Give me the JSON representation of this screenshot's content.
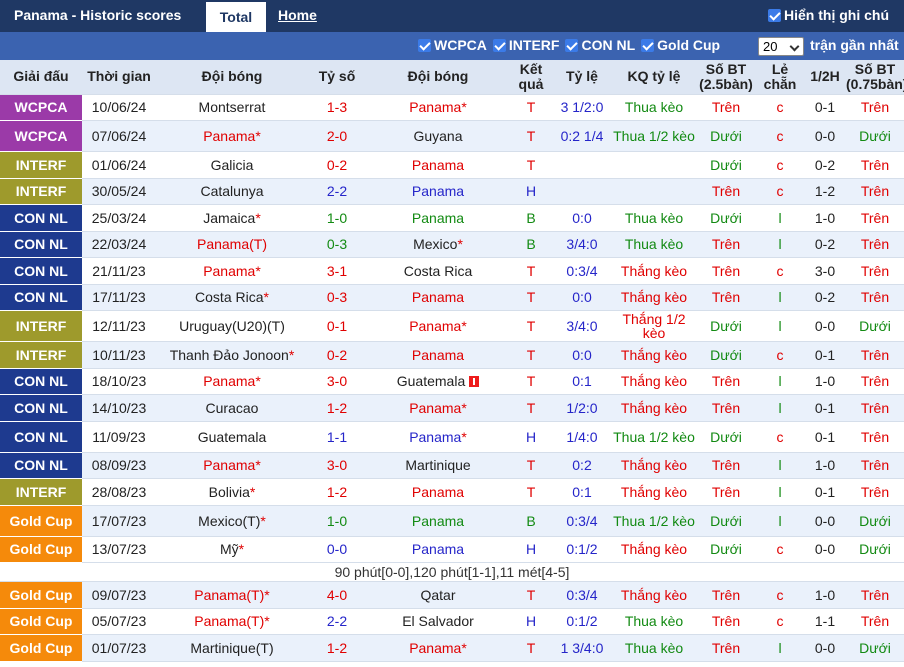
{
  "header": {
    "title": "Panama - Historic scores",
    "tab_total": "Total",
    "tab_home": "Home",
    "show_notes_label": "Hiển thị ghi chú"
  },
  "filters": {
    "leagues": [
      "WCPCA",
      "INTERF",
      "CON NL",
      "Gold Cup"
    ],
    "count_value": "20",
    "count_label": "trận gần nhất"
  },
  "colors": {
    "header_bg": "#1f3864",
    "filterbar_bg": "#3b63b0",
    "WCPCA": "#9b3aa8",
    "INTERF": "#9e9a2c",
    "CON NL": "#1e3a8f",
    "Gold Cup": "#f58a0b"
  },
  "columns": [
    "Giải đấu",
    "Thời gian",
    "Đội bóng",
    "Tỷ số",
    "Đội bóng",
    "Kết quả",
    "Tỷ lệ",
    "KQ tỷ lệ",
    "Số BT (2.5bàn)",
    "Lẻ chẵn",
    "1/2H",
    "Số BT (0.75bàn)"
  ],
  "rows": [
    {
      "league": "WCPCA",
      "date": "10/06/24",
      "home": "Montserrat",
      "home_mark": "",
      "score": "1-3",
      "away": "Panama",
      "away_mark": "*",
      "result": "T",
      "odds": "3 1/2:0",
      "odds_result": "Thua kèo",
      "ou25": "Trên",
      "oe": "c",
      "half": "0-1",
      "ou075": "Trên"
    },
    {
      "league": "WCPCA",
      "date": "07/06/24",
      "home": "Panama",
      "home_mark": "*",
      "score": "2-0",
      "away": "Guyana",
      "away_mark": "",
      "result": "T",
      "odds": "0:2 1/4",
      "odds_result": "Thua 1/2 kèo",
      "ou25": "Dưới",
      "oe": "c",
      "half": "0-0",
      "ou075": "Dưới"
    },
    {
      "league": "INTERF",
      "date": "01/06/24",
      "home": "Galicia",
      "home_mark": "",
      "score": "0-2",
      "away": "Panama",
      "away_mark": "",
      "result": "T",
      "odds": "",
      "odds_result": "",
      "ou25": "Dưới",
      "oe": "c",
      "half": "0-2",
      "ou075": "Trên"
    },
    {
      "league": "INTERF",
      "date": "30/05/24",
      "home": "Catalunya",
      "home_mark": "",
      "score": "2-2",
      "away": "Panama",
      "away_mark": "",
      "result": "H",
      "odds": "",
      "odds_result": "",
      "ou25": "Trên",
      "oe": "c",
      "half": "1-2",
      "ou075": "Trên"
    },
    {
      "league": "CON NL",
      "date": "25/03/24",
      "home": "Jamaica",
      "home_mark": "*",
      "score": "1-0",
      "away": "Panama",
      "away_mark": "",
      "result": "B",
      "odds": "0:0",
      "odds_result": "Thua kèo",
      "ou25": "Dưới",
      "oe": "l",
      "half": "1-0",
      "ou075": "Trên"
    },
    {
      "league": "CON NL",
      "date": "22/03/24",
      "home": "Panama(T)",
      "home_mark": "",
      "score": "0-3",
      "away": "Mexico",
      "away_mark": "*",
      "result": "B",
      "odds": "3/4:0",
      "odds_result": "Thua kèo",
      "ou25": "Trên",
      "oe": "l",
      "half": "0-2",
      "ou075": "Trên"
    },
    {
      "league": "CON NL",
      "date": "21/11/23",
      "home": "Panama",
      "home_mark": "*",
      "score": "3-1",
      "away": "Costa Rica",
      "away_mark": "",
      "result": "T",
      "odds": "0:3/4",
      "odds_result": "Thắng kèo",
      "ou25": "Trên",
      "oe": "c",
      "half": "3-0",
      "ou075": "Trên"
    },
    {
      "league": "CON NL",
      "date": "17/11/23",
      "home": "Costa Rica",
      "home_mark": "*",
      "score": "0-3",
      "away": "Panama",
      "away_mark": "",
      "result": "T",
      "odds": "0:0",
      "odds_result": "Thắng kèo",
      "ou25": "Trên",
      "oe": "l",
      "half": "0-2",
      "ou075": "Trên"
    },
    {
      "league": "INTERF",
      "date": "12/11/23",
      "home": "Uruguay(U20)(T)",
      "home_mark": "",
      "score": "0-1",
      "away": "Panama",
      "away_mark": "*",
      "result": "T",
      "odds": "3/4:0",
      "odds_result": "Thắng 1/2 kèo",
      "ou25": "Dưới",
      "oe": "l",
      "half": "0-0",
      "ou075": "Dưới"
    },
    {
      "league": "INTERF",
      "date": "10/11/23",
      "home": "Thanh Đảo Jonoon",
      "home_mark": "*",
      "score": "0-2",
      "away": "Panama",
      "away_mark": "",
      "result": "T",
      "odds": "0:0",
      "odds_result": "Thắng kèo",
      "ou25": "Dưới",
      "oe": "c",
      "half": "0-1",
      "ou075": "Trên"
    },
    {
      "league": "CON NL",
      "date": "18/10/23",
      "home": "Panama",
      "home_mark": "*",
      "score": "3-0",
      "away": "Guatemala",
      "away_mark": "",
      "away_card": true,
      "result": "T",
      "odds": "0:1",
      "odds_result": "Thắng kèo",
      "ou25": "Trên",
      "oe": "l",
      "half": "1-0",
      "ou075": "Trên"
    },
    {
      "league": "CON NL",
      "date": "14/10/23",
      "home": "Curacao",
      "home_mark": "",
      "score": "1-2",
      "away": "Panama",
      "away_mark": "*",
      "result": "T",
      "odds": "1/2:0",
      "odds_result": "Thắng kèo",
      "ou25": "Trên",
      "oe": "l",
      "half": "0-1",
      "ou075": "Trên"
    },
    {
      "league": "CON NL",
      "date": "11/09/23",
      "home": "Guatemala",
      "home_mark": "",
      "score": "1-1",
      "away": "Panama",
      "away_mark": "*",
      "result": "H",
      "odds": "1/4:0",
      "odds_result": "Thua 1/2 kèo",
      "ou25": "Dưới",
      "oe": "c",
      "half": "0-1",
      "ou075": "Trên"
    },
    {
      "league": "CON NL",
      "date": "08/09/23",
      "home": "Panama",
      "home_mark": "*",
      "score": "3-0",
      "away": "Martinique",
      "away_mark": "",
      "result": "T",
      "odds": "0:2",
      "odds_result": "Thắng kèo",
      "ou25": "Trên",
      "oe": "l",
      "half": "1-0",
      "ou075": "Trên"
    },
    {
      "league": "INTERF",
      "date": "28/08/23",
      "home": "Bolivia",
      "home_mark": "*",
      "score": "1-2",
      "away": "Panama",
      "away_mark": "",
      "result": "T",
      "odds": "0:1",
      "odds_result": "Thắng kèo",
      "ou25": "Trên",
      "oe": "l",
      "half": "0-1",
      "ou075": "Trên"
    },
    {
      "league": "Gold Cup",
      "date": "17/07/23",
      "home": "Mexico(T)",
      "home_mark": "*",
      "score": "1-0",
      "away": "Panama",
      "away_mark": "",
      "result": "B",
      "odds": "0:3/4",
      "odds_result": "Thua 1/2 kèo",
      "ou25": "Dưới",
      "oe": "l",
      "half": "0-0",
      "ou075": "Dưới"
    },
    {
      "league": "Gold Cup",
      "date": "13/07/23",
      "home": "Mỹ",
      "home_mark": "*",
      "score": "0-0",
      "away": "Panama",
      "away_mark": "",
      "result": "H",
      "odds": "0:1/2",
      "odds_result": "Thắng kèo",
      "ou25": "Dưới",
      "oe": "c",
      "half": "0-0",
      "ou075": "Dưới",
      "note": "90 phút[0-0],120 phút[1-1],11 mét[4-5]"
    },
    {
      "league": "Gold Cup",
      "date": "09/07/23",
      "home": "Panama(T)",
      "home_mark": "*",
      "score": "4-0",
      "away": "Qatar",
      "away_mark": "",
      "result": "T",
      "odds": "0:3/4",
      "odds_result": "Thắng kèo",
      "ou25": "Trên",
      "oe": "c",
      "half": "1-0",
      "ou075": "Trên"
    },
    {
      "league": "Gold Cup",
      "date": "05/07/23",
      "home": "Panama(T)",
      "home_mark": "*",
      "score": "2-2",
      "away": "El Salvador",
      "away_mark": "",
      "result": "H",
      "odds": "0:1/2",
      "odds_result": "Thua kèo",
      "ou25": "Trên",
      "oe": "c",
      "half": "1-1",
      "ou075": "Trên"
    },
    {
      "league": "Gold Cup",
      "date": "01/07/23",
      "home": "Martinique(T)",
      "home_mark": "",
      "score": "1-2",
      "away": "Panama",
      "away_mark": "*",
      "result": "T",
      "odds": "1 3/4:0",
      "odds_result": "Thua kèo",
      "ou25": "Trên",
      "oe": "l",
      "half": "0-0",
      "ou075": "Dưới"
    }
  ]
}
